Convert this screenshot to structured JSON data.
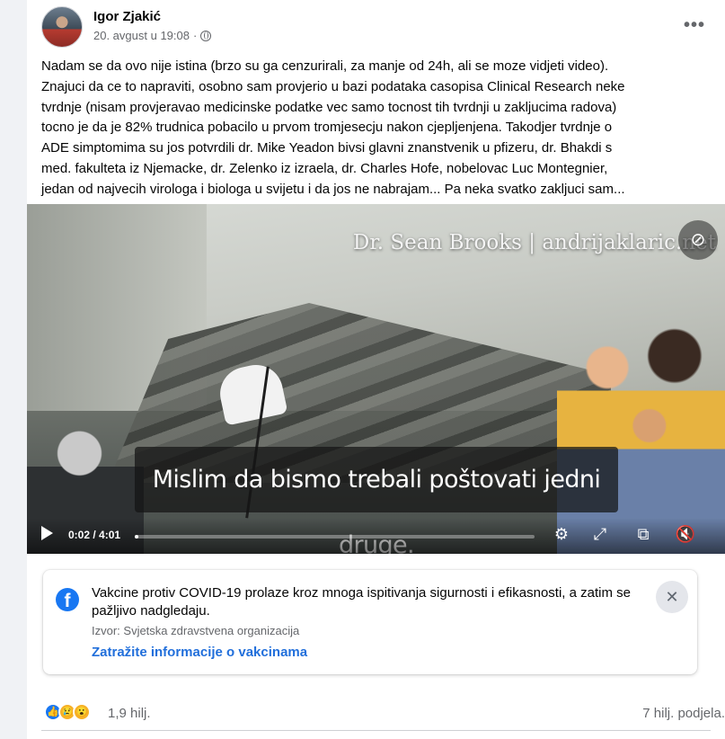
{
  "post": {
    "author": "Igor Zjakić",
    "timestamp": "20. avgust u 19:08",
    "separator": "·",
    "more_icon": "•••",
    "text": "Nadam se da ovo nije istina (brzo su ga cenzurirali, za manje od 24h, ali se moze vidjeti video).\nZnajuci da ce to napraviti, osobno sam provjerio u bazi podataka casopisa Clinical Research neke\ntvrdnje (nisam provjeravao medicinske podatke vec samo tocnost tih tvrdnji u zakljucima radova)\ntocno je da je 82% trudnica pobacilo u prvom tromjesecju nakon cjepljenjena. Takodjer tvrdnje o\nADE simptomima su jos potvrdili dr. Mike Yeadon bivsi glavni znanstvenik u pfizeru, dr. Bhakdi s\nmed. fakulteta iz Njemacke, dr. Zelenko iz izraela, dr. Charles Hofe, nobelovac Luc Montegnier,\njedan od najvecih virologa i biologa u svijetu i da jos ne nabrajam... Pa neka svatko zakljuci sam..."
  },
  "video": {
    "watermark": "Dr. Sean Brooks | andrijaklaric.net",
    "subtitle": "Mislim da bismo trebali poštovati jedni druge.",
    "time": "0:02 / 4:01",
    "progress": 0.008,
    "controls": {
      "settings_icon": "⚙",
      "fullscreen_icon": "⤢",
      "pip_icon": "⧉",
      "mute_icon": "🔇",
      "visibility_icon": "⊘"
    }
  },
  "info_box": {
    "logo": "f",
    "text": "Vakcine protiv COVID-19 prolaze kroz mnoga ispitivanja sigurnosti i efikasnosti, a zatim se pažljivo nadgledaju.",
    "source": "Izvor: Svjetska zdravstvena organizacija",
    "link": "Zatražite informacije o vakcinama",
    "close_icon": "✕"
  },
  "footer": {
    "reaction_count": "1,9 hilj.",
    "shares": "7 hilj. podjela.",
    "reaction_icons": [
      "👍",
      "😢",
      "😮"
    ]
  }
}
